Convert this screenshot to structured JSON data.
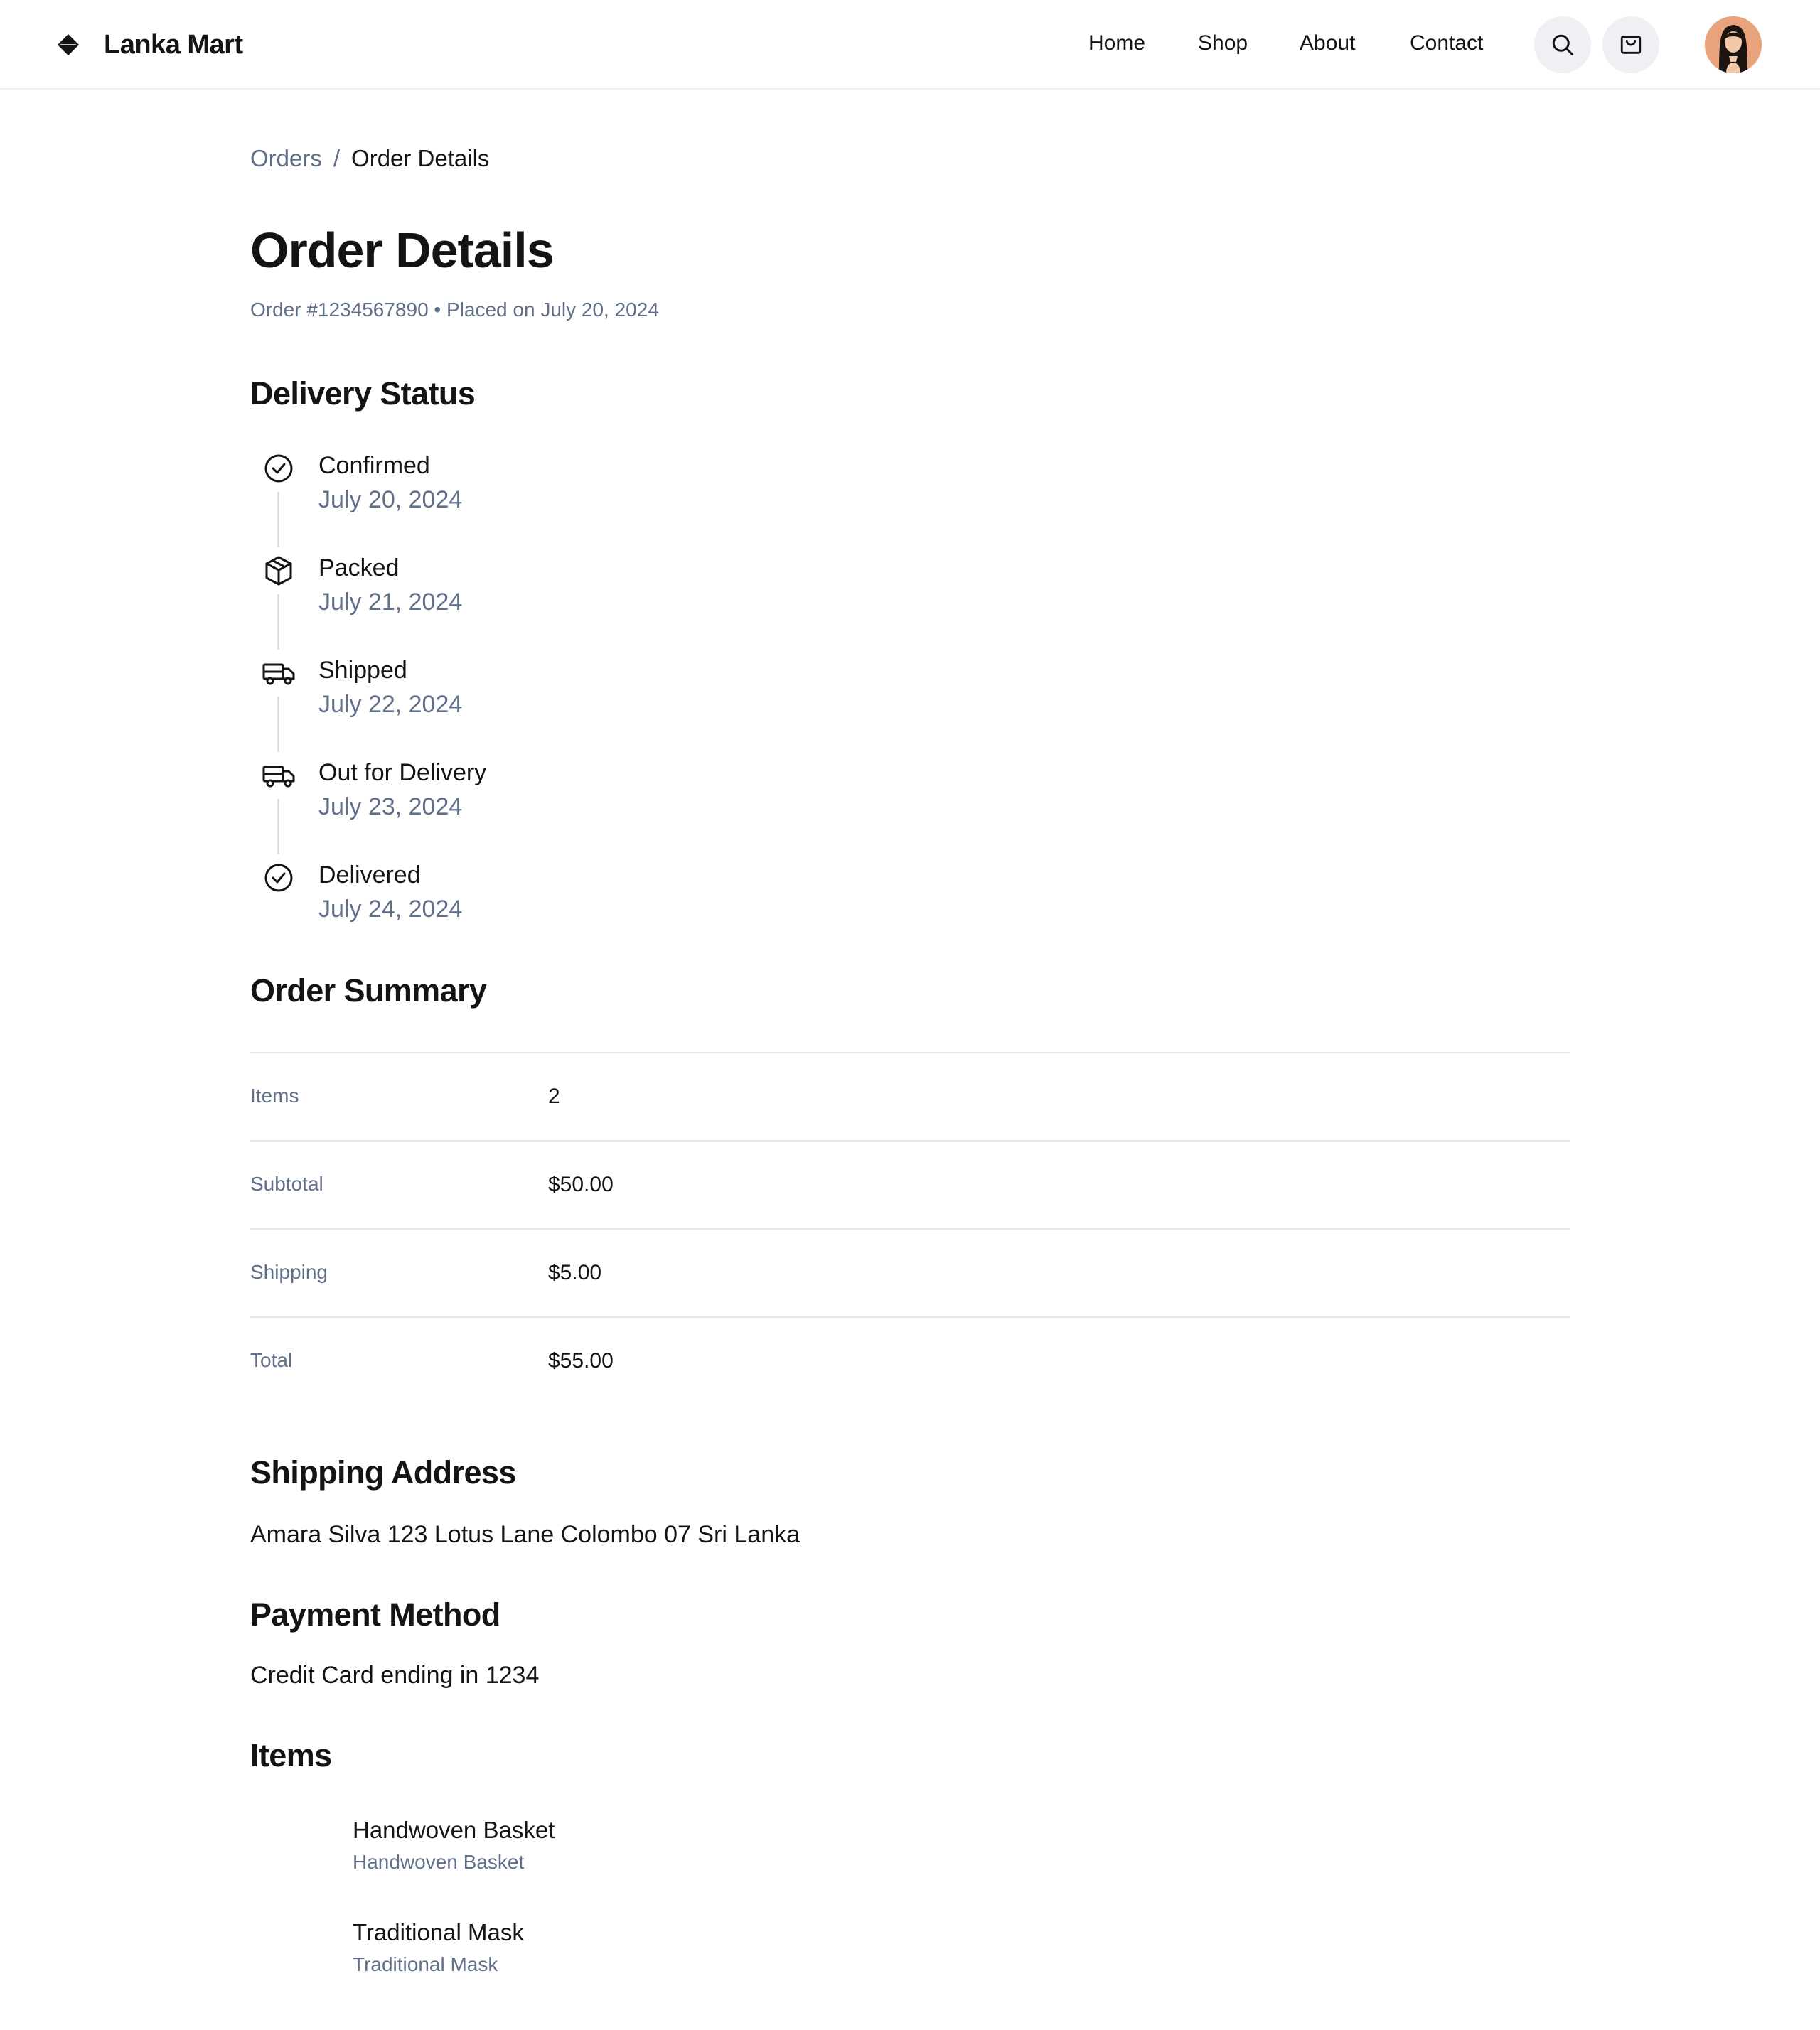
{
  "header": {
    "brand_name": "Lanka Mart",
    "nav": [
      "Home",
      "Shop",
      "About",
      "Contact"
    ]
  },
  "breadcrumb": {
    "parent": "Orders",
    "separator": "/",
    "current": "Order Details"
  },
  "page": {
    "title": "Order Details",
    "subtitle": "Order #1234567890 • Placed on July 20, 2024"
  },
  "delivery": {
    "title": "Delivery Status",
    "steps": [
      {
        "label": "Confirmed",
        "date": "July 20, 2024",
        "icon": "check-circle-icon"
      },
      {
        "label": "Packed",
        "date": "July 21, 2024",
        "icon": "package-icon"
      },
      {
        "label": "Shipped",
        "date": "July 22, 2024",
        "icon": "truck-icon"
      },
      {
        "label": "Out for Delivery",
        "date": "July 23, 2024",
        "icon": "truck-icon"
      },
      {
        "label": "Delivered",
        "date": "July 24, 2024",
        "icon": "check-circle-icon"
      }
    ]
  },
  "summary": {
    "title": "Order Summary",
    "rows": [
      {
        "label": "Items",
        "value": "2"
      },
      {
        "label": "Subtotal",
        "value": "$50.00"
      },
      {
        "label": "Shipping",
        "value": "$5.00"
      },
      {
        "label": "Total",
        "value": "$55.00"
      }
    ]
  },
  "shipping": {
    "title": "Shipping Address",
    "address": "Amara Silva 123 Lotus Lane Colombo 07 Sri Lanka"
  },
  "payment": {
    "title": "Payment Method",
    "method": "Credit Card ending in 1234"
  },
  "items": {
    "title": "Items",
    "list": [
      {
        "name": "Handwoven Basket",
        "sub": "Handwoven Basket"
      },
      {
        "name": "Traditional Mask",
        "sub": "Traditional Mask"
      }
    ]
  },
  "colors": {
    "text": "#121416",
    "muted": "#61708a",
    "divider": "#e3e5e8",
    "icon_button_bg": "#eef0f3"
  }
}
